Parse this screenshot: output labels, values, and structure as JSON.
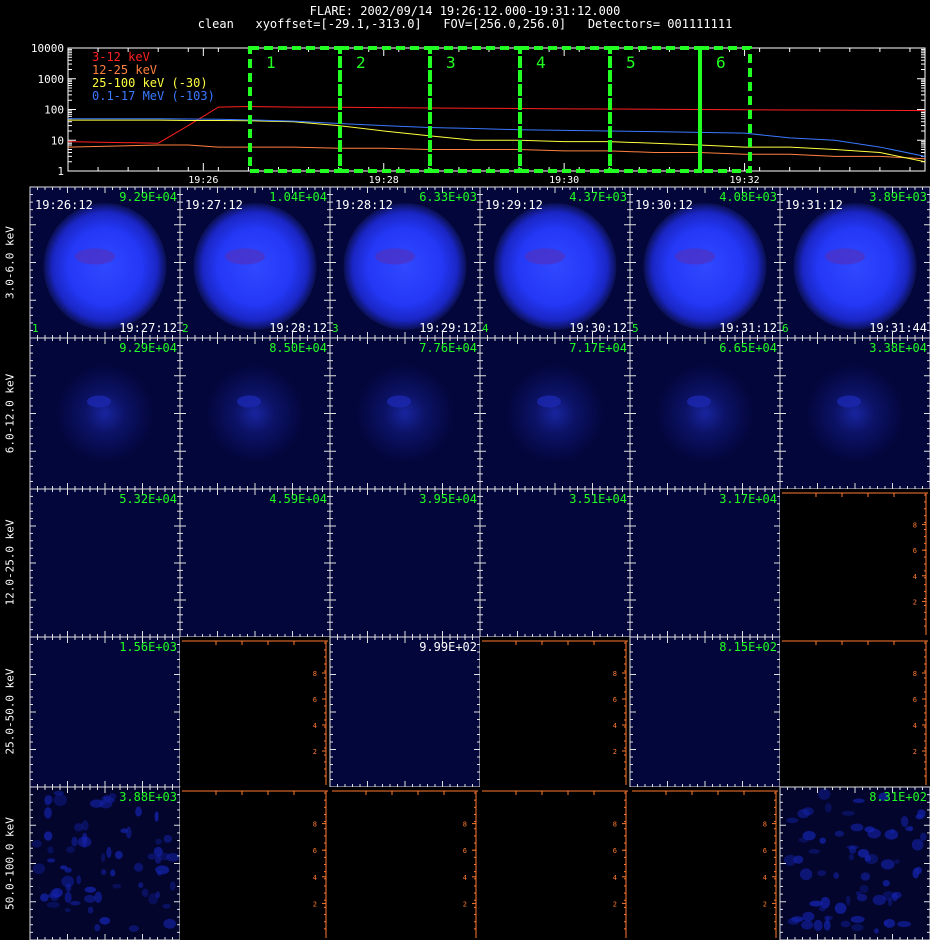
{
  "header": {
    "line1": "FLARE: 2002/09/14 19:26:12.000-19:31:12.000",
    "line2": "clean   xyoffset=[-29.1,-313.0]   FOV=[256.0,256.0]   Detectors= 001111111"
  },
  "colors": {
    "red": "#ff2020",
    "orange": "#ff7a30",
    "yellow": "#ffff40",
    "blue": "#3a78ff",
    "green": "#22ff22",
    "white": "#ffffff"
  },
  "chart_data": [
    {
      "type": "line",
      "yscale": "log",
      "ylim": [
        1,
        10000
      ],
      "ytick_labels": [
        "1",
        "10",
        "100",
        "1000",
        "10000"
      ],
      "xlim": [
        "19:24:30",
        "19:34:00"
      ],
      "xtick_labels": [
        "19:26",
        "19:28",
        "19:30",
        "19:32"
      ],
      "x": [
        "19:24:30",
        "19:25:30",
        "19:25:50",
        "19:26:10",
        "19:26:30",
        "19:27:00",
        "19:27:30",
        "19:28:00",
        "19:28:30",
        "19:29:00",
        "19:29:30",
        "19:30:00",
        "19:30:30",
        "19:31:00",
        "19:31:30",
        "19:32:00",
        "19:32:30",
        "19:33:00",
        "19:33:30",
        "19:34:00"
      ],
      "series": [
        {
          "name": "3-12 keV",
          "color": "#ff2020",
          "values": [
            9,
            8,
            30,
            120,
            125,
            120,
            118,
            115,
            112,
            110,
            108,
            105,
            104,
            102,
            100,
            98,
            96,
            95,
            94,
            92
          ]
        },
        {
          "name": "12-25 keV",
          "color": "#ff8040",
          "values": [
            6,
            7,
            7,
            6,
            6,
            6,
            5.5,
            5.5,
            5,
            5,
            5,
            4.5,
            4.5,
            4,
            4,
            3.5,
            3.5,
            3,
            3,
            2.5
          ]
        },
        {
          "name": "25-100 keV (-30)",
          "color": "#ffff40",
          "values": [
            45,
            45,
            44,
            44,
            43,
            40,
            30,
            20,
            14,
            10,
            10,
            9,
            9,
            8,
            7,
            6,
            6,
            5,
            4,
            2
          ]
        },
        {
          "name": "0.1-17 MeV (-103)",
          "color": "#3a78ff",
          "values": [
            50,
            50,
            49,
            48,
            46,
            42,
            35,
            30,
            26,
            24,
            22,
            21,
            20,
            19,
            18,
            17,
            12,
            10,
            6,
            3
          ]
        }
      ],
      "intervals": [
        "1",
        "2",
        "3",
        "4",
        "5",
        "6"
      ]
    },
    {
      "type": "heatmap",
      "row_labels": [
        "3.0-6.0 keV",
        "6.0-12.0 keV",
        "12.0-25.0 keV",
        "25.0-50.0 keV",
        "50.0-100.0 keV"
      ],
      "columns": [
        {
          "index": "1",
          "start": "19:26:12",
          "end": "19:27:12"
        },
        {
          "index": "2",
          "start": "19:27:12",
          "end": "19:28:12"
        },
        {
          "index": "3",
          "start": "19:28:12",
          "end": "19:29:12"
        },
        {
          "index": "4",
          "start": "19:29:12",
          "end": "19:30:12"
        },
        {
          "index": "5",
          "start": "19:30:12",
          "end": "19:31:12"
        },
        {
          "index": "6",
          "start": "19:31:12",
          "end": "19:31:44"
        }
      ],
      "cells": [
        [
          {
            "state": "full",
            "peak": "9.29E+04",
            "label_color": "green"
          },
          {
            "state": "full",
            "peak": "1.04E+04",
            "label_color": "green"
          },
          {
            "state": "full",
            "peak": "6.33E+03",
            "label_color": "green"
          },
          {
            "state": "full",
            "peak": "4.37E+03",
            "label_color": "green"
          },
          {
            "state": "full",
            "peak": "4.08E+03",
            "label_color": "green"
          },
          {
            "state": "full",
            "peak": "3.89E+03",
            "label_color": "green"
          }
        ],
        [
          {
            "state": "faint",
            "peak": "9.29E+04",
            "label_color": "green"
          },
          {
            "state": "faint",
            "peak": "8.50E+04",
            "label_color": "green"
          },
          {
            "state": "faint",
            "peak": "7.76E+04",
            "label_color": "green"
          },
          {
            "state": "faint",
            "peak": "7.17E+04",
            "label_color": "green"
          },
          {
            "state": "faint",
            "peak": "6.65E+04",
            "label_color": "green"
          },
          {
            "state": "faint",
            "peak": "3.38E+04",
            "label_color": "green"
          }
        ],
        [
          {
            "state": "dark",
            "peak": "5.32E+04",
            "label_color": "green"
          },
          {
            "state": "dark",
            "peak": "4.59E+04",
            "label_color": "green"
          },
          {
            "state": "dark",
            "peak": "3.95E+04",
            "label_color": "green"
          },
          {
            "state": "dark",
            "peak": "3.51E+04",
            "label_color": "green"
          },
          {
            "state": "dark",
            "peak": "3.17E+04",
            "label_color": "green"
          },
          {
            "state": "empty",
            "peak": "",
            "label_color": "green"
          }
        ],
        [
          {
            "state": "dark",
            "peak": "1.56E+03",
            "label_color": "green"
          },
          {
            "state": "empty",
            "peak": "",
            "label_color": "green"
          },
          {
            "state": "dark",
            "peak": "9.99E+02",
            "label_color": "white"
          },
          {
            "state": "empty",
            "peak": "",
            "label_color": "green"
          },
          {
            "state": "dark",
            "peak": "8.15E+02",
            "label_color": "green"
          },
          {
            "state": "empty",
            "peak": "",
            "label_color": "green"
          }
        ],
        [
          {
            "state": "noise",
            "peak": "3.88E+03",
            "label_color": "green"
          },
          {
            "state": "empty",
            "peak": "",
            "label_color": "green"
          },
          {
            "state": "empty",
            "peak": "",
            "label_color": "green"
          },
          {
            "state": "empty",
            "peak": "",
            "label_color": "green"
          },
          {
            "state": "empty",
            "peak": "",
            "label_color": "green"
          },
          {
            "state": "noise",
            "peak": "8.31E+02",
            "label_color": "green"
          }
        ]
      ],
      "empty_axis_ticks": [
        "2",
        "4",
        "6",
        "8"
      ]
    }
  ]
}
